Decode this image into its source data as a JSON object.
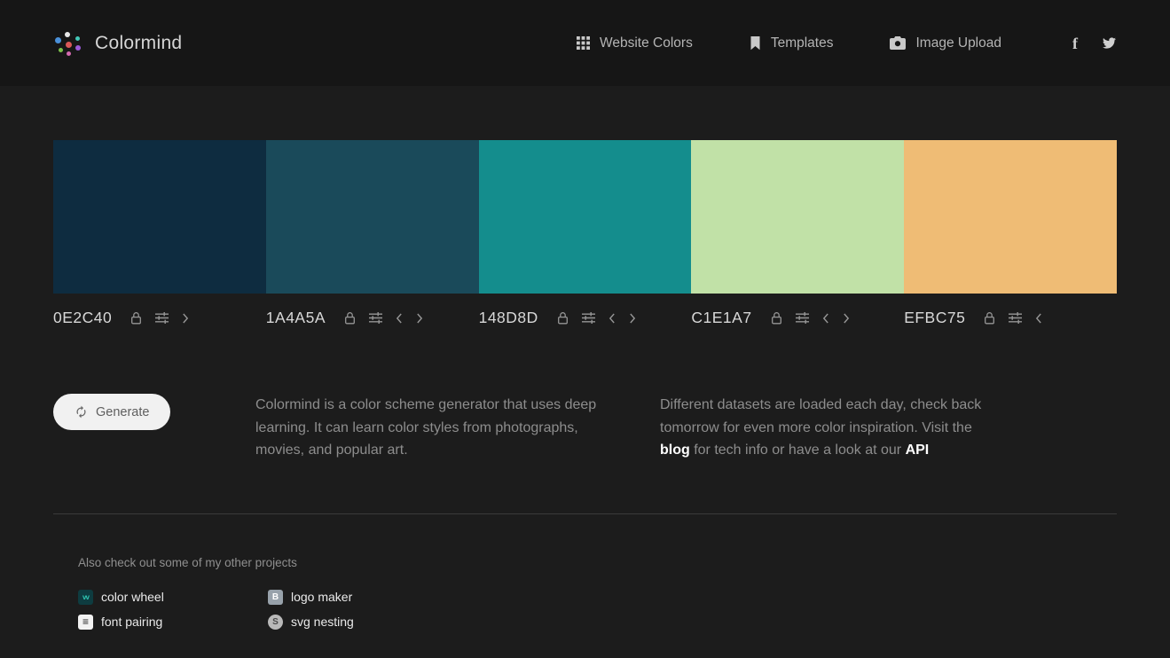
{
  "header": {
    "logo_text": "Colormind",
    "nav": [
      {
        "label": "Website Colors",
        "icon": "grid-icon"
      },
      {
        "label": "Templates",
        "icon": "bookmark-icon"
      },
      {
        "label": "Image Upload",
        "icon": "camera-icon"
      }
    ],
    "social": [
      {
        "icon": "facebook-icon",
        "glyph": "f"
      },
      {
        "icon": "twitter-icon"
      }
    ]
  },
  "palette": {
    "swatches": [
      {
        "hex_label": "0E2C40",
        "color": "#0e2c40"
      },
      {
        "hex_label": "1A4A5A",
        "color": "#1a4a5a"
      },
      {
        "hex_label": "148D8D",
        "color": "#148d8d"
      },
      {
        "hex_label": "C1E1A7",
        "color": "#c1e1a7"
      },
      {
        "hex_label": "EFBC75",
        "color": "#efbc75"
      }
    ]
  },
  "actions": {
    "generate_label": "Generate"
  },
  "description": {
    "left": "Colormind is a color scheme generator that uses deep learning. It can learn color styles from photographs, movies, and popular art.",
    "right_before_blog": "Different datasets are loaded each day, check back tomorrow for even more color inspiration. Visit the ",
    "blog_link": "blog",
    "right_between": " for tech info or have a look at our ",
    "api_link": "API"
  },
  "footer": {
    "heading": "Also check out some of my other projects",
    "projects": [
      {
        "label": "color wheel",
        "icon": "color-wheel-icon",
        "glyph": "vv"
      },
      {
        "label": "logo maker",
        "icon": "logo-maker-icon",
        "glyph": "B"
      },
      {
        "label": "font pairing",
        "icon": "font-pairing-icon",
        "glyph": "≡"
      },
      {
        "label": "svg nesting",
        "icon": "svg-nesting-icon",
        "glyph": "S"
      }
    ]
  }
}
